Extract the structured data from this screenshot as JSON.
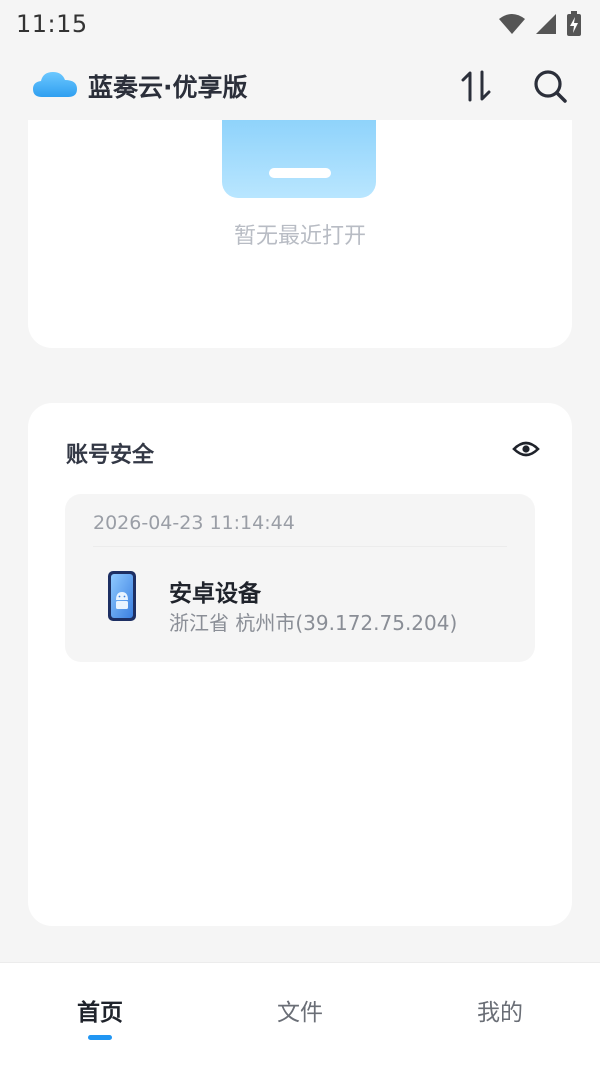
{
  "status_bar": {
    "time": "11:15",
    "icons": [
      "wifi-icon",
      "signal-icon",
      "battery-charging-icon"
    ]
  },
  "app_bar": {
    "logo_icon": "cloud-logo-icon",
    "title": "蓝奏云·优享版",
    "actions": [
      "transfer-icon",
      "search-icon"
    ]
  },
  "recent": {
    "empty_text": "暂无最近打开"
  },
  "security": {
    "title": "账号安全",
    "eye_icon": "eye-icon",
    "record": {
      "time": "2026-04-23 11:14:44",
      "device_name": "安卓设备",
      "location": "浙江省 杭州市(39.172.75.204)",
      "device_icon": "android-phone-icon"
    }
  },
  "bottom_nav": {
    "items": [
      {
        "label": "首页",
        "active": true
      },
      {
        "label": "文件",
        "active": false
      },
      {
        "label": "我的",
        "active": false
      }
    ]
  },
  "colors": {
    "accent": "#2196f3",
    "background": "#f5f5f5",
    "card": "#ffffff"
  }
}
